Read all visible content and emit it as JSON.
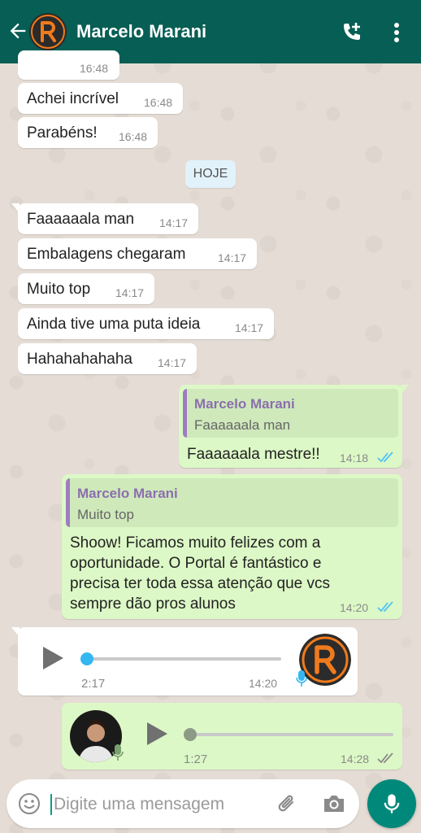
{
  "header": {
    "contact_name": "Marcelo Marani",
    "colors": {
      "bar": "#075e54",
      "avatar_accent": "#f07b1d"
    }
  },
  "messages_earlier": [
    {
      "time": "16:48"
    },
    {
      "text": "Achei incrível",
      "time": "16:48"
    },
    {
      "text": "Parabéns!",
      "time": "16:48"
    }
  ],
  "date_divider": "HOJE",
  "messages_today": [
    {
      "text": "Faaaaaala man",
      "time": "14:17"
    },
    {
      "text": "Embalagens chegaram",
      "time": "14:17"
    },
    {
      "text": "Muito top",
      "time": "14:17"
    },
    {
      "text": "Ainda tive uma puta ideia",
      "time": "14:17"
    },
    {
      "text": "Hahahahahaha",
      "time": "14:17"
    }
  ],
  "reply_1": {
    "quote_author": "Marcelo Marani",
    "quote_text": "Faaaaaala man",
    "text": "Faaaaaala mestre!!",
    "time": "14:18",
    "status": "read"
  },
  "reply_2": {
    "quote_author": "Marcelo Marani",
    "quote_text": "Muito top",
    "lines": [
      "Shoow! Ficamos muito felizes com a",
      "oportunidade. O Portal é fantástico e",
      "precisa ter toda essa atenção que vcs",
      "sempre dão pros alunos"
    ],
    "time": "14:20",
    "status": "read"
  },
  "voice_incoming": {
    "duration": "2:17",
    "time": "14:20",
    "progress": 0
  },
  "voice_outgoing": {
    "duration": "1:27",
    "time": "14:28",
    "progress": 0,
    "status": "delivered"
  },
  "composer": {
    "placeholder": "Digite uma mensagem"
  },
  "icons": [
    "back-arrow-icon",
    "add-call-icon",
    "more-vert-icon",
    "emoji-icon",
    "attach-icon",
    "camera-icon",
    "mic-icon",
    "play-icon"
  ]
}
